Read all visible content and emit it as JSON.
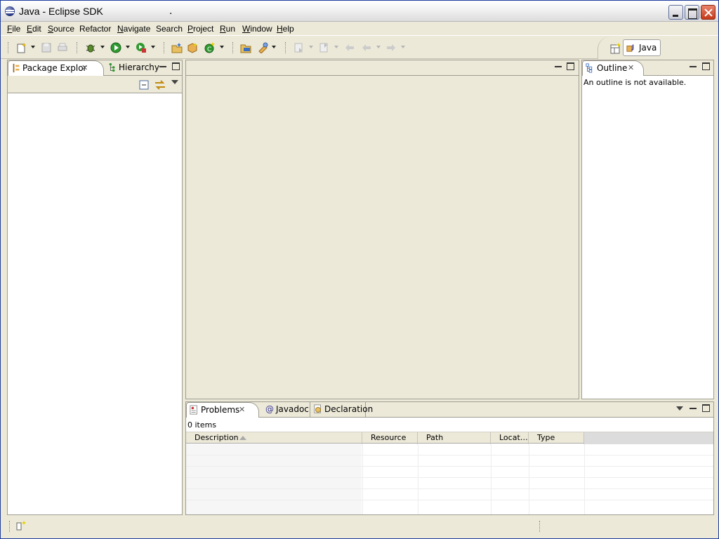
{
  "window": {
    "title": "Java - Eclipse SDK",
    "title_dot": "."
  },
  "menu": [
    {
      "label": "File",
      "ul": "F",
      "rest": "ile"
    },
    {
      "label": "Edit",
      "ul": "E",
      "rest": "dit"
    },
    {
      "label": "Source",
      "ul": "S",
      "rest": "ource"
    },
    {
      "label": "Refactor",
      "ul": "",
      "rest": "Refactor"
    },
    {
      "label": "Navigate",
      "ul": "N",
      "rest": "avigate"
    },
    {
      "label": "Search",
      "ul": "",
      "rest": "Search"
    },
    {
      "label": "Project",
      "ul": "P",
      "rest": "roject"
    },
    {
      "label": "Run",
      "ul": "R",
      "rest": "un"
    },
    {
      "label": "Window",
      "ul": "W",
      "rest": "indow"
    },
    {
      "label": "Help",
      "ul": "H",
      "rest": "elp"
    }
  ],
  "perspective": {
    "label": "Java"
  },
  "package_explorer": {
    "tab": "Package Explor",
    "tab2": "Hierarchy"
  },
  "outline": {
    "tab": "Outline",
    "message": "An outline is not available."
  },
  "problems": {
    "tabs": [
      "Problems",
      "Javadoc",
      "Declaration"
    ],
    "count": "0 items",
    "columns": [
      "Description",
      "Resource",
      "Path",
      "Locat…",
      "Type"
    ]
  },
  "colors": {
    "frame_blue": "#0a246a",
    "chrome": "#ece9d8",
    "border": "#9f9d92"
  }
}
